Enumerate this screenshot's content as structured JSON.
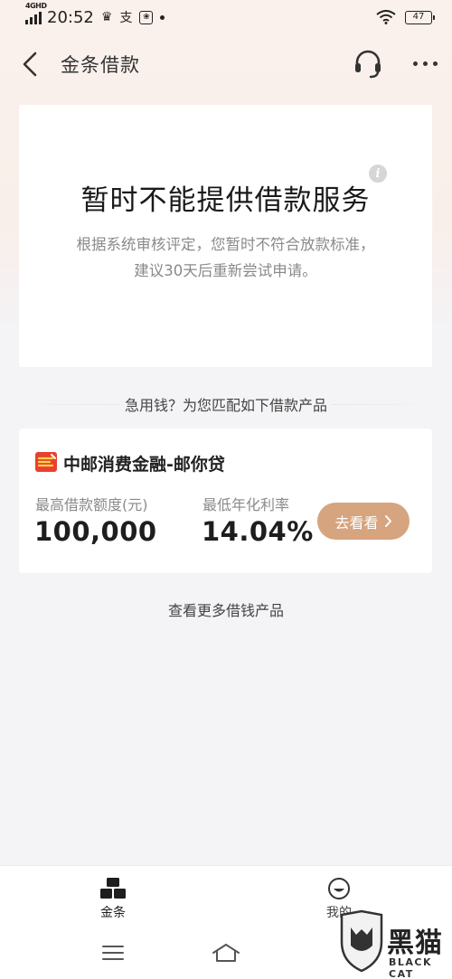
{
  "status_bar": {
    "network": "4GHD",
    "time": "20:52",
    "app_mark": "支",
    "battery": "47"
  },
  "nav": {
    "title": "金条借款"
  },
  "notice": {
    "title": "暂时不能提供借款服务",
    "desc_line1": "根据系统审核评定，您暂时不符合放款标准，",
    "desc_line2": "建议30天后重新尝试申请。"
  },
  "recommend": {
    "header": "急用钱？为您匹配如下借款产品"
  },
  "product": {
    "name": "中邮消费金融-邮你贷",
    "amount_label": "最高借款额度(元)",
    "amount_value": "100,000",
    "rate_label": "最低年化利率",
    "rate_value": "14.04%",
    "button_label": "去看看",
    "logo_color": "#e8412c"
  },
  "more_products": "查看更多借钱产品",
  "tabs": [
    {
      "label": "金条",
      "active": true
    },
    {
      "label": "我的",
      "active": false
    }
  ],
  "watermark": {
    "text": "黑猫",
    "sub": "BLACK CAT"
  },
  "colors": {
    "accent": "#d6a47e",
    "background": "#f4f3f5"
  }
}
